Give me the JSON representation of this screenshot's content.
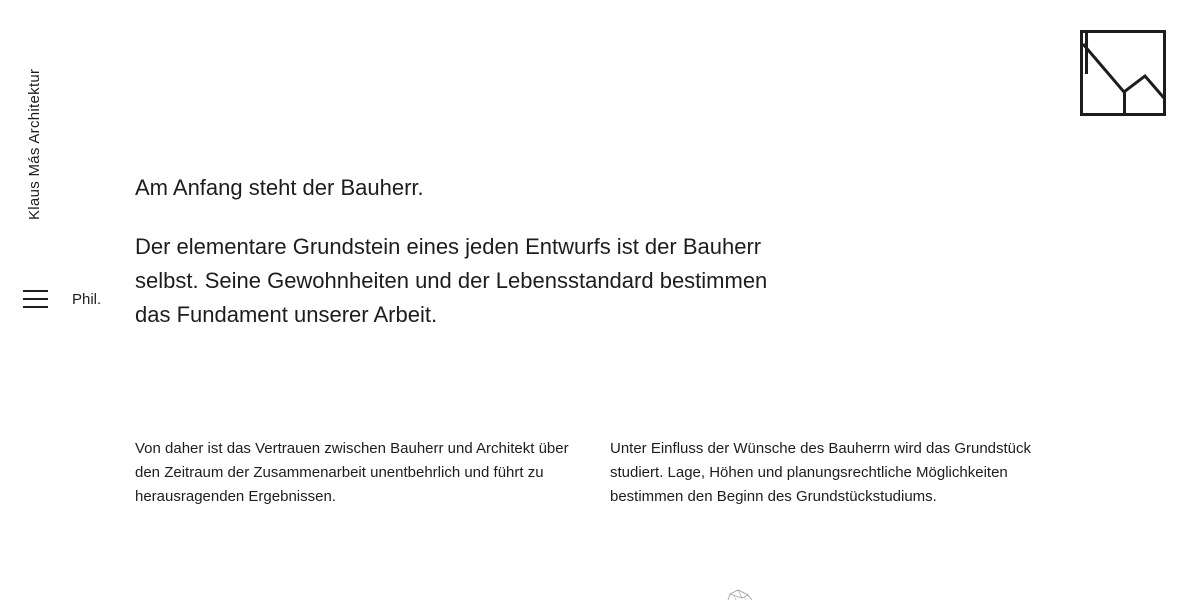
{
  "brand": {
    "name": "Klaus Más Architektur"
  },
  "nav": {
    "section_label": "Phil.",
    "menu_icon": "hamburger-menu-icon"
  },
  "logo": {
    "icon": "km-monogram-logo",
    "letters": "KM"
  },
  "main": {
    "headline": "Am Anfang steht der Bauherr.",
    "lead": "Der elementare Grundstein eines jeden Entwurfs ist der Bauherr selbst. Seine Gewohnheiten und der Lebensstandard bestimmen das Fundament unserer Arbeit.",
    "columns": [
      "Von daher ist das Vertrauen zwischen Bauherr und Architekt über den Zeitraum der Zusammenarbeit unentbehrlich und führt zu herausragenden Ergebnissen.",
      "Unter Einfluss der Wünsche des Bauherrn wird das Grundstück studiert. Lage, Höhen und planungsrechtliche Möglichkeiten bestimmen den Beginn des Grundstückstudiums."
    ]
  },
  "colors": {
    "text": "#1d1d1b",
    "background": "#ffffff",
    "sketch": "#9a9a9a"
  }
}
